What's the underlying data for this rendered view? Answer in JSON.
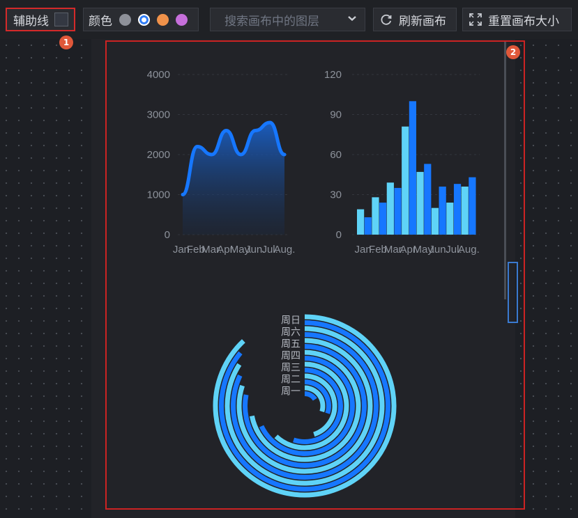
{
  "toolbar": {
    "aux_label": "辅助线",
    "color_label": "颜色",
    "color_options": [
      "#8e9199",
      "#2f7cf6",
      "#f0924a",
      "#c66fdb"
    ],
    "search_placeholder": "搜索画布中的图层",
    "refresh_label": "刷新画布",
    "reset_label": "重置画布大小"
  },
  "markers": [
    "1",
    "2"
  ],
  "colors": {
    "accent": "#1677ff",
    "light": "#5fd3f7",
    "frame": "#cc2323",
    "badge": "#e0583a"
  },
  "chart_data": [
    {
      "type": "area",
      "categories": [
        "Jan.",
        "Feb.",
        "Mar.",
        "Apr.",
        "May.",
        "Jun.",
        "Jul.",
        "Aug."
      ],
      "values": [
        1000,
        2200,
        2000,
        2600,
        2000,
        2600,
        2800,
        2000
      ],
      "yticks": [
        "0",
        "1000",
        "2000",
        "3000",
        "4000"
      ],
      "ylim": [
        0,
        4000
      ]
    },
    {
      "type": "bar",
      "categories": [
        "Jan.",
        "Feb.",
        "Mar.",
        "Apr.",
        "May.",
        "Jun.",
        "Jul.",
        "Aug."
      ],
      "series": [
        {
          "values": [
            19,
            28,
            39,
            81,
            47,
            20,
            24,
            36
          ]
        },
        {
          "values": [
            13,
            24,
            35,
            100,
            53,
            36,
            38,
            43
          ]
        }
      ],
      "yticks": [
        "0",
        "30",
        "60",
        "90",
        "120"
      ],
      "ylim": [
        0,
        120
      ]
    },
    {
      "type": "radial-bar",
      "categories": [
        "周一",
        "周二",
        "周三",
        "周四",
        "周五",
        "周六",
        "周日"
      ],
      "series": [
        {
          "values": [
            16,
            30,
            55,
            68,
            78,
            82,
            86
          ]
        },
        {
          "values": [
            30,
            45,
            62,
            72,
            80,
            84,
            88
          ]
        }
      ],
      "max": 100
    }
  ]
}
